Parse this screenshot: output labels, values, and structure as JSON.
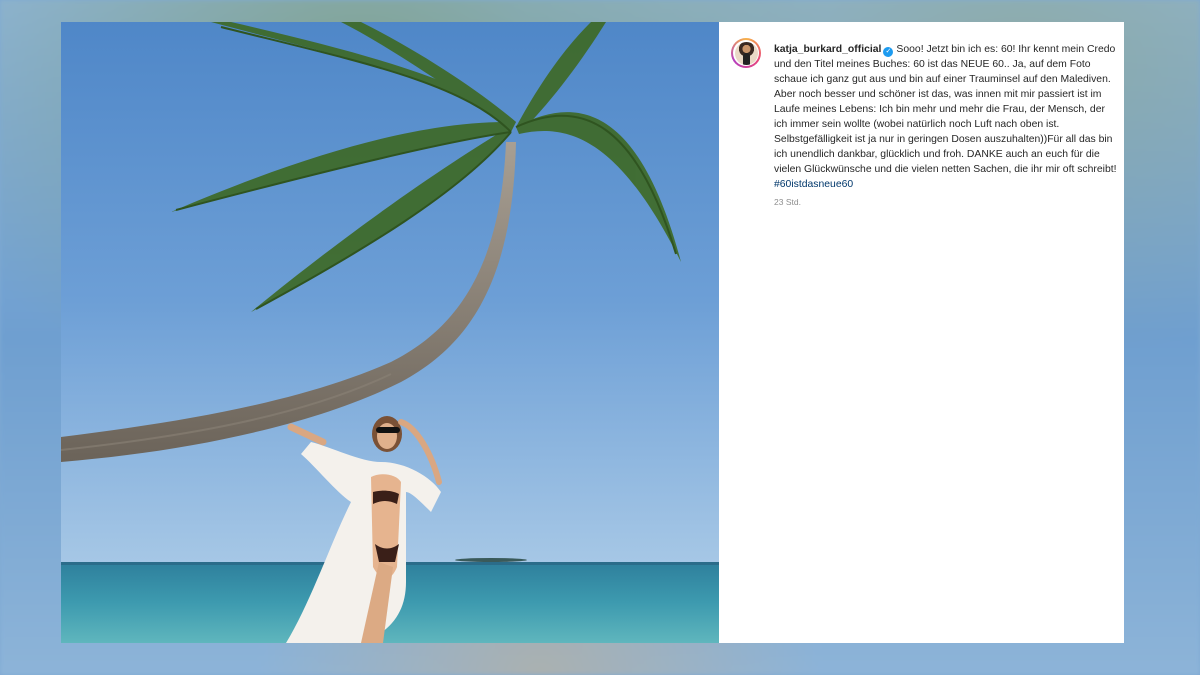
{
  "post": {
    "username": "katja_burkard_official",
    "verified": true,
    "caption_text": "Sooo! Jetzt bin ich es: 60! Ihr kennt mein Credo und den Titel meines Buches: 60 ist das NEUE 60.. Ja, auf dem Foto schaue ich ganz gut aus und bin auf einer Trauminsel auf den Malediven. Aber noch besser und schöner ist das, was innen mit mir passiert ist im Laufe meines Lebens: Ich bin mehr und mehr die Frau, der Mensch, der ich immer sein wollte (wobei natürlich noch Luft nach oben ist. Selbstgefälligkeit ist ja nur in geringen Dosen auszuhalten))Für all das bin ich unendlich dankbar, glücklich und froh. DANKE auch an euch für die vielen Glückwünsche und die vielen netten Sachen, die ihr mir oft schreibt! ",
    "hashtag": "#60istdasneue60",
    "timestamp": "23 Std.",
    "icons": {
      "verified": "verified-badge-icon",
      "avatar": "profile-avatar"
    },
    "colors": {
      "verified": "#1d9bf0",
      "hashtag": "#00376b",
      "timestamp": "#8e8e8e"
    }
  }
}
